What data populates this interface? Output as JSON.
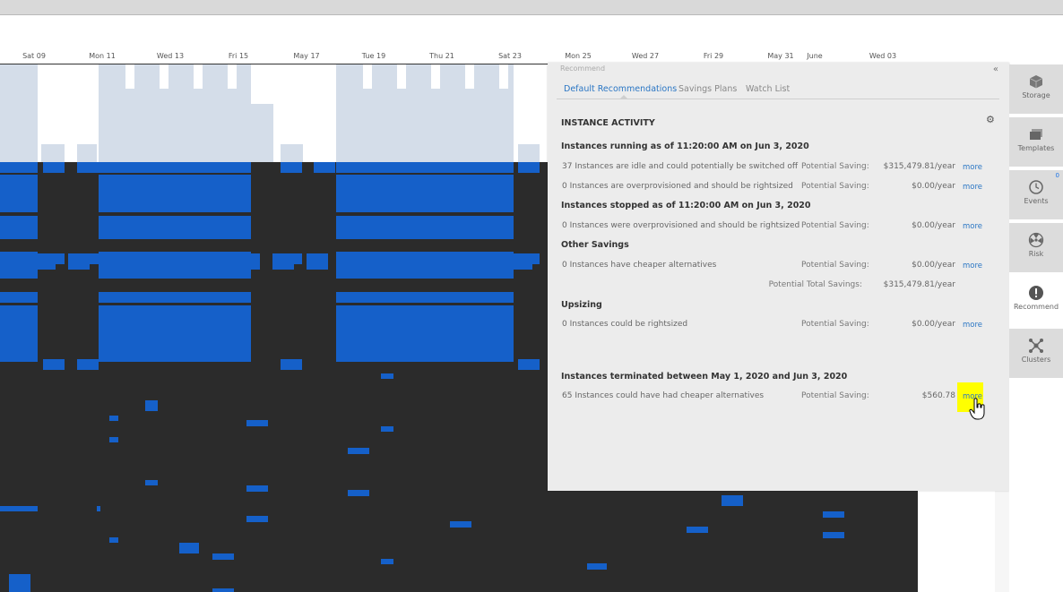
{
  "timeline": {
    "ticks": [
      "Sat 09",
      "Mon 11",
      "Wed 13",
      "Fri 15",
      "May 17",
      "Tue 19",
      "Thu 21",
      "Sat 23",
      "Mon 25",
      "Wed 27",
      "Fri 29",
      "May 31",
      "June",
      "Wed 03"
    ]
  },
  "colors": {
    "chart_bg": "#2b2b2b",
    "bar_blue": "#1560c9",
    "area_fill": "#d4dde9",
    "link": "#2a76c4",
    "highlight": "#ffff00"
  },
  "panel": {
    "title": "Recommend",
    "collapse_icon": "double-chevron-left-icon",
    "tabs": [
      {
        "label": "Default Recommendations",
        "active": true
      },
      {
        "label": "Savings Plans",
        "active": false
      },
      {
        "label": "Watch List",
        "active": false
      }
    ],
    "section_title": "INSTANCE ACTIVITY",
    "gear_icon": "gear-icon",
    "groups": {
      "running": {
        "heading": "Instances running as of 11:20:00 AM on Jun 3, 2020",
        "rows": [
          {
            "desc": "37 Instances are idle and could potentially be switched off",
            "label": "Potential Saving:",
            "value": "$315,479.81/year",
            "more": "more"
          },
          {
            "desc": "0 Instances are overprovisioned and should be rightsized",
            "label": "Potential Saving:",
            "value": "$0.00/year",
            "more": "more"
          }
        ]
      },
      "stopped": {
        "heading": "Instances stopped as of 11:20:00 AM on Jun 3, 2020",
        "rows": [
          {
            "desc": "0 Instances were overprovisioned and should be rightsized",
            "label": "Potential Saving:",
            "value": "$0.00/year",
            "more": "more"
          }
        ]
      },
      "other": {
        "heading": "Other Savings",
        "rows": [
          {
            "desc": "0 Instances have cheaper alternatives",
            "label": "Potential Saving:",
            "value": "$0.00/year",
            "more": "more"
          }
        ],
        "total_label": "Potential Total Savings:",
        "total_value": "$315,479.81/year"
      },
      "upsizing": {
        "heading": "Upsizing",
        "rows": [
          {
            "desc": "0 Instances could be rightsized",
            "label": "Potential Saving:",
            "value": "$0.00/year",
            "more": "more"
          }
        ]
      },
      "terminated": {
        "heading": "Instances terminated between May 1, 2020 and Jun 3, 2020",
        "rows": [
          {
            "desc": "65 Instances could have had cheaper alternatives",
            "label": "Potential Saving:",
            "value": "$560.78",
            "more": "more"
          }
        ]
      }
    }
  },
  "sidebar": {
    "items": [
      {
        "label": "Storage",
        "icon": "cube-icon"
      },
      {
        "label": "Templates",
        "icon": "stack-icon"
      },
      {
        "label": "Events",
        "icon": "clock-icon",
        "badge": "0"
      },
      {
        "label": "Risk",
        "icon": "hazard-icon"
      },
      {
        "label": "Recommend",
        "icon": "exclamation-icon",
        "active": true
      },
      {
        "label": "Clusters",
        "icon": "network-icon"
      }
    ]
  }
}
